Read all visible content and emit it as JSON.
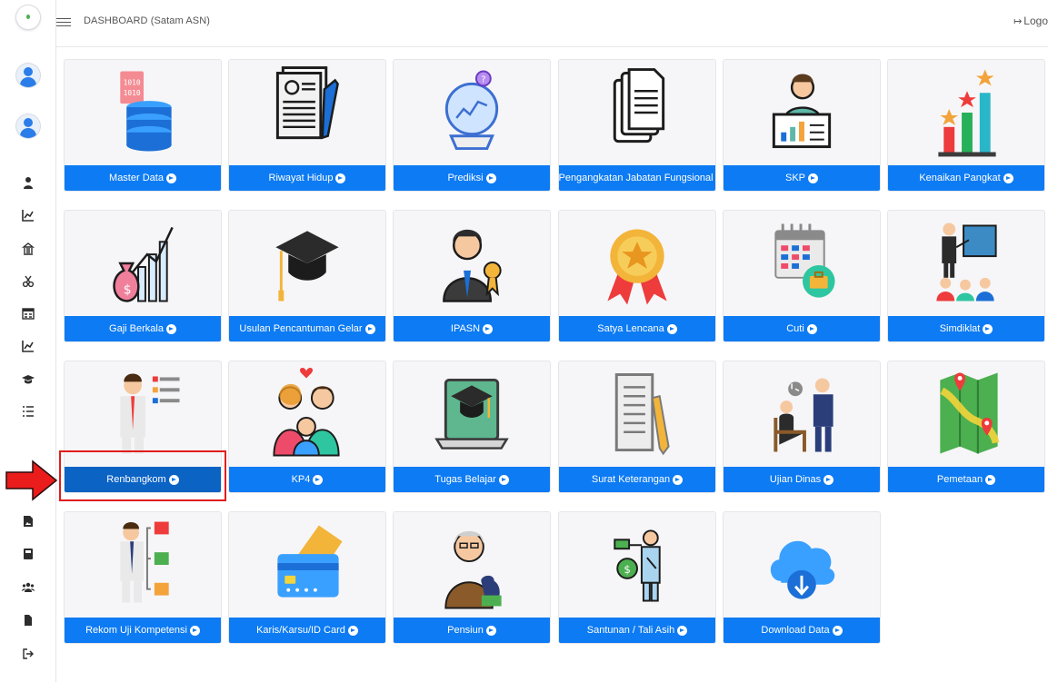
{
  "header": {
    "title": "DASHBOARD (Satam ASN)",
    "logout_label": "Logo"
  },
  "colors": {
    "bar_blue": "#0d7bf3",
    "bar_active": "#0b63c4",
    "highlight_red": "#e21c1c"
  },
  "sidebar": {
    "icons": [
      "user-icon",
      "chart-icon",
      "building-icon",
      "scissors-icon",
      "calendar-icon",
      "chart-icon",
      "graduation-cap-icon",
      "list-icon",
      "file-image-icon",
      "book-icon",
      "users-icon",
      "file-icon",
      "logout-icon"
    ]
  },
  "menu": {
    "master_data": "Master Data",
    "riwayat_hidup": "Riwayat Hidup",
    "prediksi": "Prediksi",
    "pengangkatan": "Pengangkatan Jabatan Fungsional",
    "skp": "SKP",
    "kenaikan_pangkat": "Kenaikan Pangkat",
    "gaji_berkala": "Gaji Berkala",
    "usulan_gelar": "Usulan Pencantuman Gelar",
    "ipasn": "IPASN",
    "satya_lencana": "Satya Lencana",
    "cuti": "Cuti",
    "simdiklat": "Simdiklat",
    "renbangkom": "Renbangkom",
    "kp4": "KP4",
    "tugas_belajar": "Tugas Belajar",
    "surat_keterangan": "Surat Keterangan",
    "ujian_dinas": "Ujian Dinas",
    "pemetaan": "Pemetaan",
    "rekom_uji": "Rekom Uji Kompetensi",
    "karis": "Karis/Karsu/ID Card",
    "pensiun": "Pensiun",
    "santunan": "Santunan / Tali Asih",
    "download_data": "Download Data"
  }
}
